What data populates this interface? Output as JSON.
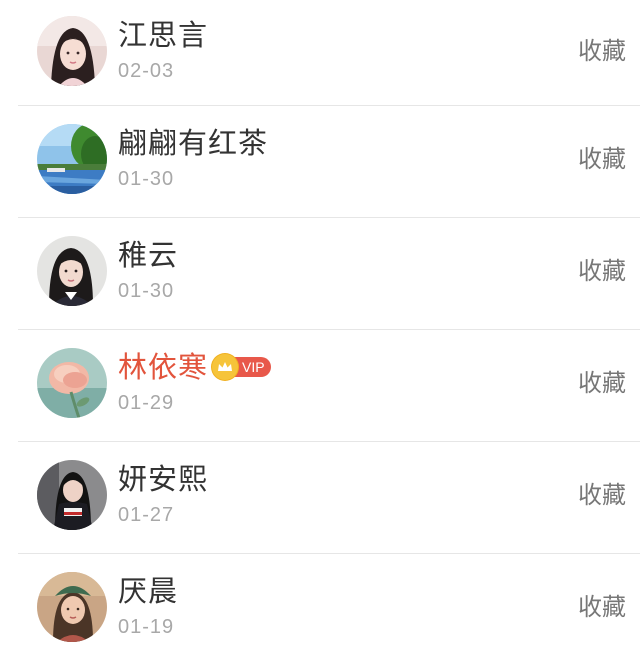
{
  "rows": [
    {
      "name": "江思言",
      "date": "02-03",
      "action": "收藏",
      "vip": false,
      "avatar": "avatar-portrait-girl-pink"
    },
    {
      "name": "翩翩有红茶",
      "date": "01-30",
      "action": "收藏",
      "vip": false,
      "avatar": "avatar-landscape-lake"
    },
    {
      "name": "稚云",
      "date": "01-30",
      "action": "收藏",
      "vip": false,
      "avatar": "avatar-portrait-girl-school"
    },
    {
      "name": "林依寒",
      "date": "01-29",
      "action": "收藏",
      "vip": true,
      "vip_label": "VIP",
      "avatar": "avatar-pink-rose"
    },
    {
      "name": "妍安熙",
      "date": "01-27",
      "action": "收藏",
      "vip": false,
      "avatar": "avatar-portrait-girl-dark"
    },
    {
      "name": "厌晨",
      "date": "01-19",
      "action": "收藏",
      "vip": false,
      "avatar": "avatar-portrait-girl-green-hat"
    }
  ],
  "colors": {
    "name": "#333333",
    "vip_name": "#e2543c",
    "vip_badge": "#e8584a",
    "crown": "#f6c43a",
    "date": "#a8a8a8",
    "action": "#777777",
    "divider": "#e6e6e6"
  }
}
